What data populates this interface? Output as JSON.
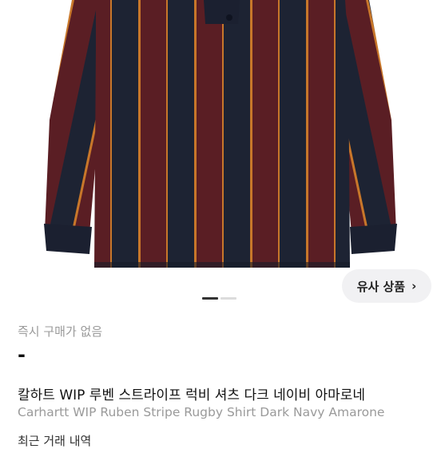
{
  "product": {
    "image_alt": "Carhartt WIP Ruben Stripe Rugby Shirt",
    "stripe_colors": {
      "navy": "#1d2333",
      "burgundy": "#5a1e24",
      "orange": "#c8772a",
      "background": "#ffffff"
    },
    "carousel": {
      "total": 2,
      "active": 1
    },
    "similar_button": {
      "label": "유사 상품",
      "icon": "chevron-right-icon"
    },
    "instant_buy": "즉시 구매가 없음",
    "price": "-",
    "title_ko": "칼하트 WIP 루벤 스트라이프 럭비 셔츠 다크 네이비 아마로네",
    "title_en": "Carhartt WIP Ruben Stripe Rugby Shirt Dark Navy Amarone",
    "partial_text": "최근 거래 내역"
  }
}
